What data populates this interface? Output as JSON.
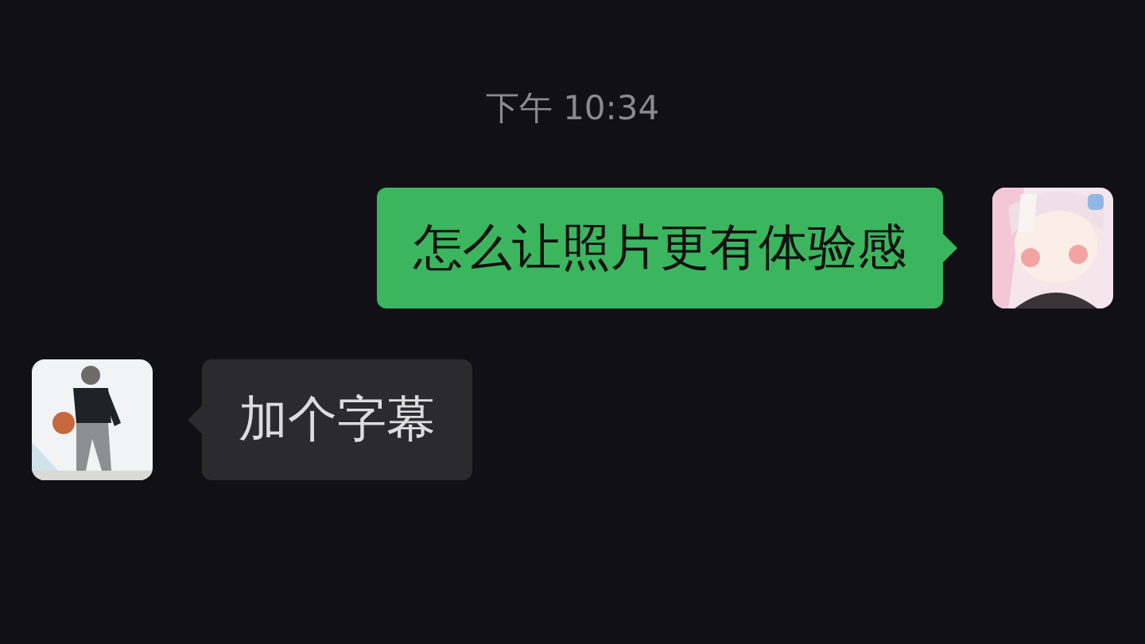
{
  "timestamp": "下午 10:34",
  "messages": [
    {
      "kind": "sent",
      "text": "怎么让照片更有体验感"
    },
    {
      "kind": "received",
      "text": "加个字幕"
    }
  ]
}
